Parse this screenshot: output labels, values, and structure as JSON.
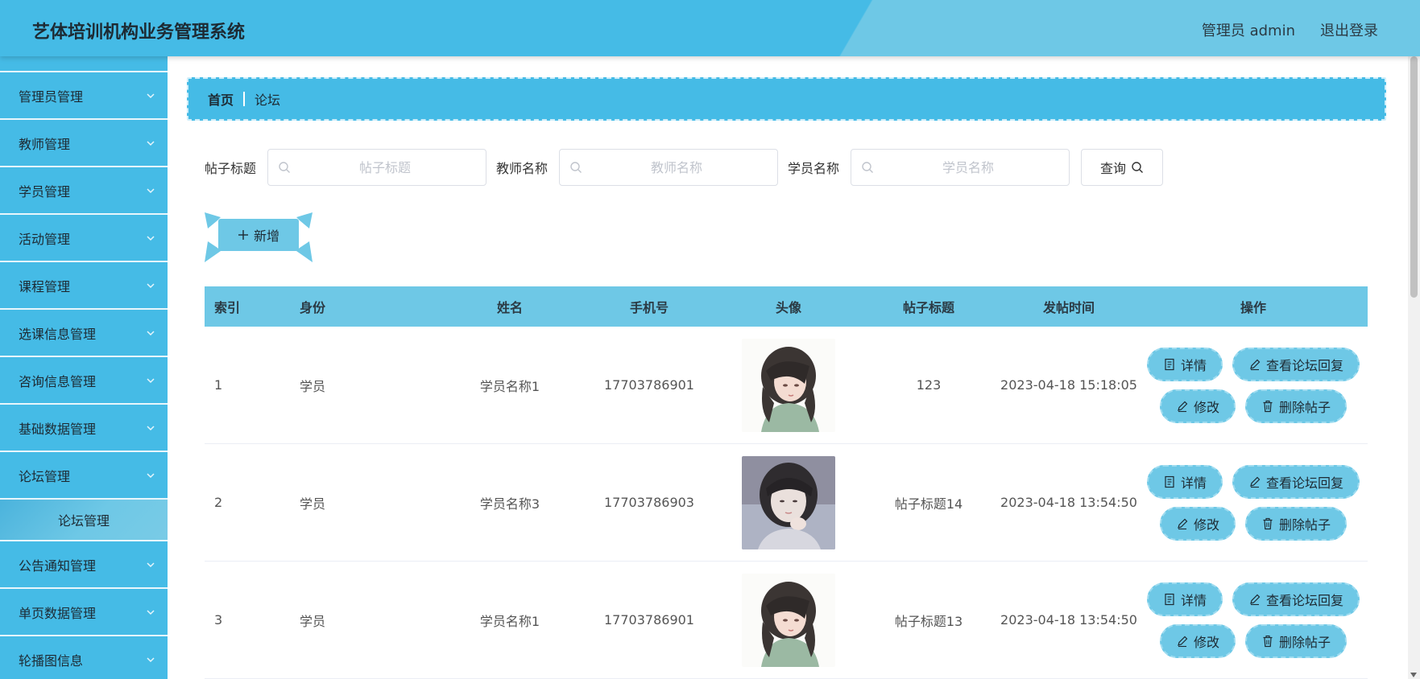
{
  "app": {
    "title": "艺体培训机构业务管理系统"
  },
  "header": {
    "user": "管理员 admin",
    "logout": "退出登录"
  },
  "sidebar": {
    "items": [
      {
        "label": "管理员管理"
      },
      {
        "label": "教师管理"
      },
      {
        "label": "学员管理"
      },
      {
        "label": "活动管理"
      },
      {
        "label": "课程管理"
      },
      {
        "label": "选课信息管理"
      },
      {
        "label": "咨询信息管理"
      },
      {
        "label": "基础数据管理"
      },
      {
        "label": "论坛管理"
      },
      {
        "label": "公告通知管理"
      },
      {
        "label": "单页数据管理"
      },
      {
        "label": "轮播图信息"
      }
    ],
    "submenu": {
      "label": "论坛管理"
    }
  },
  "breadcrumb": {
    "home": "首页",
    "current": "论坛"
  },
  "search": {
    "post_title_label": "帖子标题",
    "post_title_placeholder": "帖子标题",
    "teacher_label": "教师名称",
    "teacher_placeholder": "教师名称",
    "student_label": "学员名称",
    "student_placeholder": "学员名称",
    "query_label": "查询"
  },
  "actions": {
    "add_label": "新增"
  },
  "table": {
    "headers": [
      "索引",
      "身份",
      "姓名",
      "手机号",
      "头像",
      "帖子标题",
      "发帖时间",
      "操作"
    ],
    "rows": [
      {
        "index": "1",
        "role": "学员",
        "name": "学员名称1",
        "phone": "17703786901",
        "title": "123",
        "time": "2023-04-18 15:18:05",
        "avatar": "illustrated-girl"
      },
      {
        "index": "2",
        "role": "学员",
        "name": "学员名称3",
        "phone": "17703786903",
        "title": "帖子标题14",
        "time": "2023-04-18 13:54:50",
        "avatar": "photo-girl"
      },
      {
        "index": "3",
        "role": "学员",
        "name": "学员名称1",
        "phone": "17703786901",
        "title": "帖子标题13",
        "time": "2023-04-18 13:54:50",
        "avatar": "illustrated-girl"
      }
    ],
    "ops": {
      "detail": "详情",
      "view_replies": "查看论坛回复",
      "edit": "修改",
      "delete": "删除帖子"
    }
  },
  "colors": {
    "header": "#45bbe6",
    "sidebar": "#45bbe6",
    "table_head": "#6ec8e6",
    "button": "#6ec8e6"
  }
}
